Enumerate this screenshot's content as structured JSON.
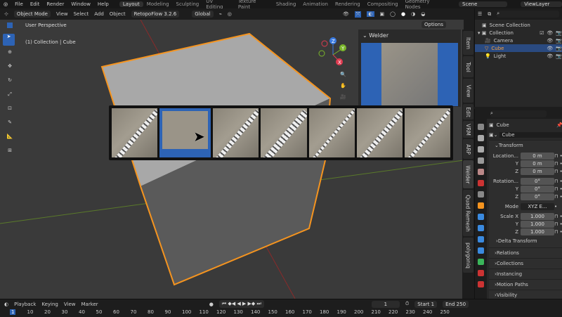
{
  "topbar": {
    "menus": [
      "File",
      "Edit",
      "Render",
      "Window",
      "Help"
    ],
    "workspaces": [
      "Layout",
      "Modeling",
      "Sculpting",
      "UV Editing",
      "Texture Paint",
      "Shading",
      "Animation",
      "Rendering",
      "Compositing",
      "Geometry Nodes"
    ],
    "active_workspace": "Layout",
    "scene": "Scene",
    "view_layer": "ViewLayer"
  },
  "viewport_header": {
    "mode": "Object Mode",
    "menus": [
      "View",
      "Select",
      "Add",
      "Object"
    ],
    "addon": "RetopoFlow 3.2.6",
    "orientation": "Global",
    "options": "Options"
  },
  "viewport": {
    "info_line1": "User Perspective",
    "info_line2": "(1) Collection | Cube",
    "gizmo_axes": [
      "Z",
      "Y",
      "X"
    ]
  },
  "welder_panel": {
    "title": "Welder"
  },
  "n_tabs": [
    "Item",
    "Tool",
    "View",
    "Edit",
    "VRM",
    "ARP",
    "Welder",
    "Quad Remesh",
    "polygoniq"
  ],
  "outliner": {
    "items": [
      {
        "label": "Scene Collection",
        "depth": 0
      },
      {
        "label": "Collection",
        "depth": 1
      },
      {
        "label": "Camera",
        "depth": 2
      },
      {
        "label": "Cube",
        "depth": 2,
        "selected": true
      },
      {
        "label": "Light",
        "depth": 2
      }
    ]
  },
  "properties": {
    "object_name": "Cube",
    "data_name": "Cube",
    "transform_label": "Transform",
    "location": {
      "label": "Location...",
      "x": "0 m",
      "y": "0 m",
      "z": "0 m"
    },
    "rotation": {
      "label": "Rotation...",
      "x": "0°",
      "y": "0°",
      "z": "0°"
    },
    "mode_label": "Mode",
    "mode": "XYZ E...",
    "scale": {
      "label": "Scale X",
      "x": "1.000",
      "y": "1.000",
      "z": "1.000"
    },
    "axis": {
      "y": "Y",
      "z": "Z"
    },
    "delta": "Delta Transform",
    "sections": [
      "Relations",
      "Collections",
      "Instancing",
      "Motion Paths",
      "Visibility"
    ]
  },
  "timeline": {
    "menus": [
      "Playback",
      "Keying",
      "View",
      "Marker"
    ],
    "current_frame": "1",
    "start_label": "Start",
    "start": "1",
    "end_label": "End",
    "end": "250",
    "ticks": [
      "1",
      "10",
      "20",
      "30",
      "40",
      "50",
      "60",
      "70",
      "80",
      "90",
      "100",
      "110",
      "120",
      "130",
      "140",
      "150",
      "160",
      "170",
      "180",
      "190",
      "200",
      "210",
      "220",
      "230",
      "240",
      "250"
    ]
  },
  "thumbnails": {
    "count": 7,
    "selected_index": 1
  },
  "colors": {
    "accent": "#2d63b5",
    "selection": "#f5941f"
  }
}
